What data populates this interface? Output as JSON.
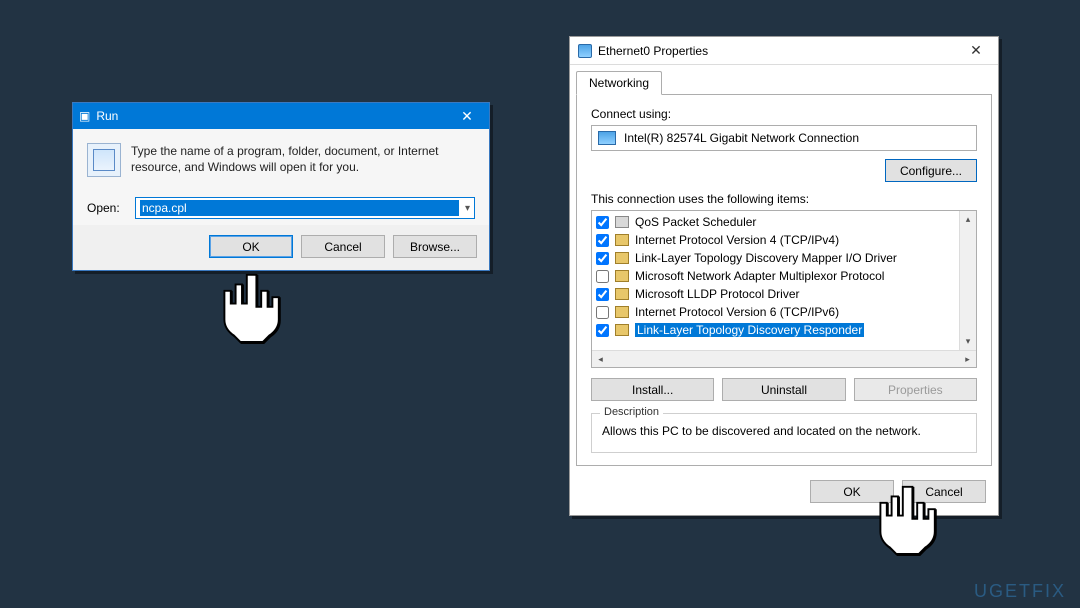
{
  "watermark": "UGETFIX",
  "run": {
    "title": "Run",
    "close": "✕",
    "info": "Type the name of a program, folder, document, or Internet resource, and Windows will open it for you.",
    "open_label": "Open:",
    "input_value": "ncpa.cpl",
    "buttons": {
      "ok": "OK",
      "cancel": "Cancel",
      "browse": "Browse..."
    }
  },
  "props": {
    "title": "Ethernet0 Properties",
    "close": "✕",
    "tab": "Networking",
    "connect_label": "Connect using:",
    "adapter": "Intel(R) 82574L Gigabit Network Connection",
    "configure": "Configure...",
    "uses_label": "This connection uses the following items:",
    "items": [
      {
        "checked": true,
        "icon": "qs",
        "label": "QoS Packet Scheduler"
      },
      {
        "checked": true,
        "icon": "p",
        "label": "Internet Protocol Version 4 (TCP/IPv4)"
      },
      {
        "checked": true,
        "icon": "p",
        "label": "Link-Layer Topology Discovery Mapper I/O Driver"
      },
      {
        "checked": false,
        "icon": "p",
        "label": "Microsoft Network Adapter Multiplexor Protocol"
      },
      {
        "checked": true,
        "icon": "p",
        "label": "Microsoft LLDP Protocol Driver"
      },
      {
        "checked": false,
        "icon": "p",
        "label": "Internet Protocol Version 6 (TCP/IPv6)"
      },
      {
        "checked": true,
        "icon": "p",
        "label": "Link-Layer Topology Discovery Responder",
        "selected": true
      }
    ],
    "buttons": {
      "install": "Install...",
      "uninstall": "Uninstall",
      "properties": "Properties"
    },
    "desc_legend": "Description",
    "description": "Allows this PC to be discovered and located on the network.",
    "footer": {
      "ok": "OK",
      "cancel": "Cancel"
    }
  }
}
